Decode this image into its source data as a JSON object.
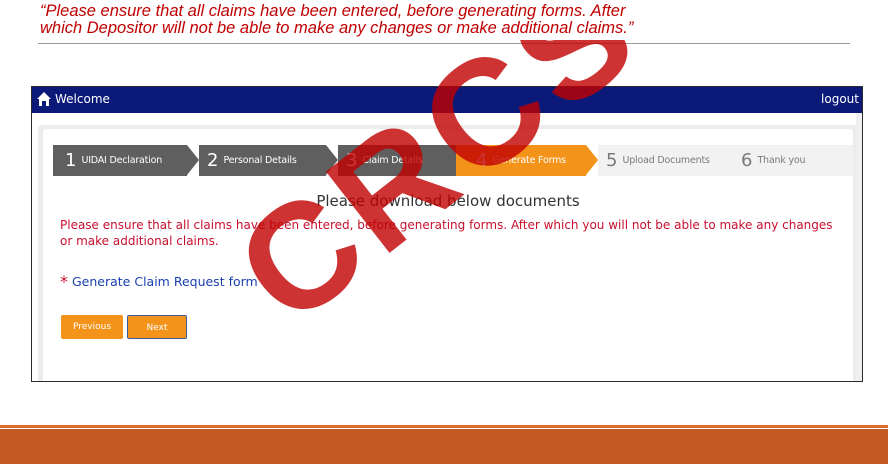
{
  "quote": {
    "line1": "“Please ensure that all claims have been entered, before generating forms. After",
    "line2": "which Depositor will not be able to make any changes or make additional claims.”"
  },
  "topbar": {
    "welcome": "Welcome",
    "logout": "logout"
  },
  "steps": [
    {
      "num": "1",
      "label": "UIDAI Declaration",
      "state": "done"
    },
    {
      "num": "2",
      "label": "Personal Details",
      "state": "done"
    },
    {
      "num": "3",
      "label": "Claim Details",
      "state": "done"
    },
    {
      "num": "4",
      "label": "Generate Forms",
      "state": "active"
    },
    {
      "num": "5",
      "label": "Upload Documents",
      "state": "todo"
    },
    {
      "num": "6",
      "label": "Thank you",
      "state": "todo"
    }
  ],
  "main": {
    "title": "Please download below documents",
    "warning_line1": "Please ensure that all claims have been entered, before generating forms. After which you will not be able to make any changes",
    "warning_line2": "or make additional claims.",
    "required_mark": "*",
    "generate_link": "Generate Claim Request form",
    "prev_label": "Previous",
    "next_label": "Next"
  },
  "watermark": {
    "text": "CRCS"
  },
  "colors": {
    "accent": "#f39319",
    "topbar": "#0b1a78",
    "warning": "#c8102e",
    "footer": "#c45a23"
  }
}
